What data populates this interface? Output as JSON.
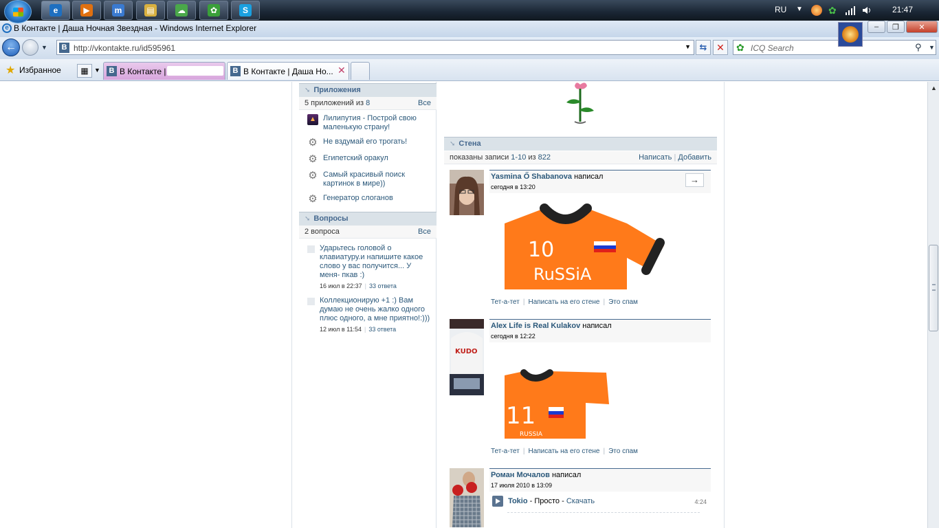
{
  "taskbar": {
    "lang": "RU",
    "time": "21:47",
    "buttons": [
      {
        "name": "ie-taskbar-button",
        "glyph": "e",
        "color": "#1e6fc0",
        "active": true
      },
      {
        "name": "media-player-taskbar-button",
        "glyph": "▶",
        "color": "#e07010",
        "active": false
      },
      {
        "name": "mail-agent-taskbar-button",
        "glyph": "m",
        "color": "#3a7ad0",
        "active": false
      },
      {
        "name": "explorer-taskbar-button",
        "glyph": "▤",
        "color": "#d8b040",
        "active": false
      },
      {
        "name": "network-taskbar-button",
        "glyph": "☁",
        "color": "#4aa84a",
        "active": false
      },
      {
        "name": "icq-taskbar-button",
        "glyph": "✿",
        "color": "#3aa03a",
        "active": false
      },
      {
        "name": "skype-taskbar-button",
        "glyph": "S",
        "color": "#1aa0e0",
        "active": false
      }
    ]
  },
  "window": {
    "title": "В Контакте | Даша Ночная Звездная - Windows Internet Explorer",
    "address": "http://vkontakte.ru/id595961",
    "search_placeholder": "ICQ Search",
    "favorites_label": "Избранное",
    "tabs": [
      {
        "label": "В Контакте |"
      },
      {
        "label": "В Контакте | Даша Но..."
      }
    ]
  },
  "apps": {
    "title": "Приложения",
    "count_text": "5 приложений из",
    "count_link": "8",
    "all_link": "Все",
    "items": [
      {
        "label": "Лилипутия - Построй свою маленькую страну!",
        "icon": "liliputia-icon"
      },
      {
        "label": "Не вздумай его трогать!",
        "icon": "gear-icon"
      },
      {
        "label": "Египетский оракул",
        "icon": "gear-icon"
      },
      {
        "label": "Самый красивый поиск картинок в мире))",
        "icon": "gear-icon"
      },
      {
        "label": "Генератор слоганов",
        "icon": "gear-icon"
      }
    ]
  },
  "questions": {
    "title": "Вопросы",
    "count_text": "2 вопроса",
    "all_link": "Все",
    "items": [
      {
        "text": "Ударьтесь головой о клавиатуру.и напишите какое слово у вас получится... У меня- пкав :)",
        "date": "16 июл в 22:37",
        "answers": "33 ответа"
      },
      {
        "text": "Коллекционирую +1 :) Вам думаю не очень жалко одного плюс одного, а мне приятно!:)))",
        "date": "12 июл в 11:54",
        "answers": "33 ответа"
      }
    ]
  },
  "wall": {
    "title": "Стена",
    "shown_prefix": "показаны записи",
    "shown_range": "1-10",
    "shown_of": "из",
    "shown_total": "822",
    "write_link": "Написать",
    "add_link": "Добавить",
    "posts": [
      {
        "author": "Yasmina Ő Shabanova",
        "wrote": "написал",
        "date": "сегодня в 13:20",
        "reply": "→",
        "shirt": {
          "number": "10",
          "text": "RuSSiA"
        },
        "actions": [
          "Тет-а-тет",
          "Написать на его стене",
          "Это спам"
        ]
      },
      {
        "author": "Alex Life is Real Kulakov",
        "wrote": "написал",
        "date": "сегодня в 12:22",
        "avatar_text": "KUDO",
        "shirt": {
          "number": "11",
          "text": "RUSSIA"
        },
        "actions": [
          "Тет-а-тет",
          "Написать на его стене",
          "Это спам"
        ]
      },
      {
        "author": "Роман Мочалов",
        "wrote": "написал",
        "date": "17 июля 2010 в 13:09",
        "audio": {
          "artist": "Tokio",
          "dash1": "-",
          "title": "Просто",
          "dash2": "-",
          "download": "Скачать",
          "duration": "4:24"
        }
      }
    ]
  },
  "colors": {
    "link": "#2b587a",
    "header_bg": "#dae2e8",
    "shirt": "#ff7a1a"
  }
}
